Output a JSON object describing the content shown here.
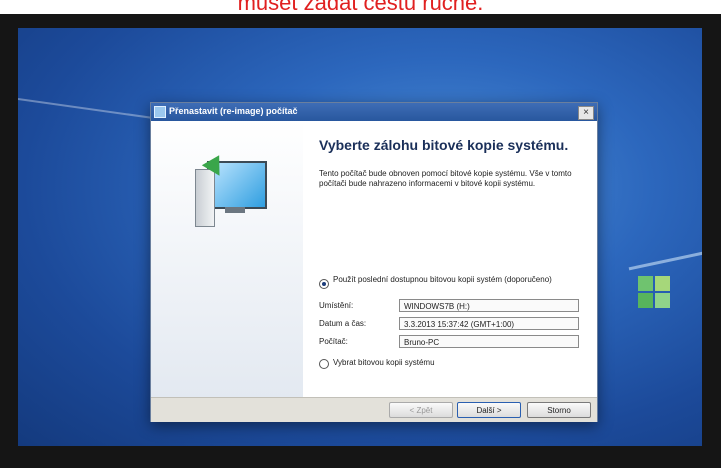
{
  "caption": "muset zadat cestu ručně.",
  "dialog": {
    "title": "Přenastavit (re-image) počítač",
    "close_label": "×",
    "heading": "Vyberte zálohu bitové kopie systému.",
    "description": "Tento počítač bude obnoven pomocí bitové kopie systému. Vše v tomto počítači bude nahrazeno informacemi v bitové kopii systému.",
    "option_latest": "Použít poslední dostupnou bitovou kopii systém (doporučeno)",
    "fields": {
      "location_label": "Umístění:",
      "location_value": "WINDOWS7B (H:)",
      "date_label": "Datum a čas:",
      "date_value": "3.3.2013 15:37:42 (GMT+1:00)",
      "computer_label": "Počítač:",
      "computer_value": "Bruno-PC"
    },
    "option_select": "Vybrat bitovou kopii systému",
    "buttons": {
      "back": "< Zpět",
      "next": "Další >",
      "cancel": "Storno"
    }
  },
  "colors": {
    "desktop": "#2c67bd",
    "caption": "#e02020",
    "title_bar": "#28579e"
  }
}
